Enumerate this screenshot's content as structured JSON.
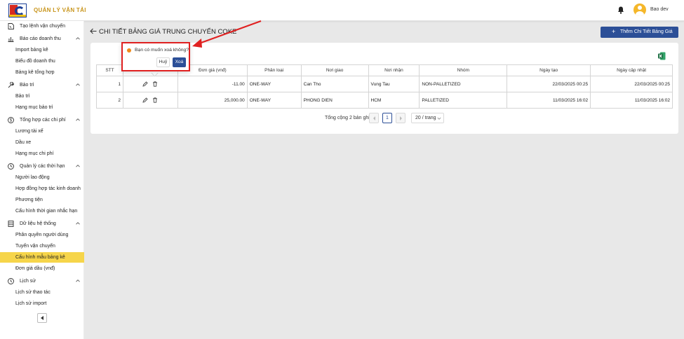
{
  "app": {
    "title": "QUẢN LÝ VẬN TẢI",
    "user": "Bao dev"
  },
  "sidebar": {
    "items": [
      {
        "type": "group",
        "icon": "file-icon",
        "label": "Tạo lệnh vận chuyển",
        "chevron": false
      },
      {
        "type": "group",
        "icon": "bar-chart-icon",
        "label": "Báo cáo doanh thu",
        "chevron": true
      },
      {
        "type": "sub",
        "label": "Import bảng kê"
      },
      {
        "type": "sub",
        "label": "Biểu đồ doanh thu"
      },
      {
        "type": "sub",
        "label": "Bảng kê tổng hợp"
      },
      {
        "type": "group",
        "icon": "wrench-icon",
        "label": "Bảo trì",
        "chevron": true
      },
      {
        "type": "sub",
        "label": "Bảo trì"
      },
      {
        "type": "sub",
        "label": "Hạng mục bảo trì"
      },
      {
        "type": "group",
        "icon": "dollar-icon",
        "label": "Tổng hợp các chi phí",
        "chevron": true
      },
      {
        "type": "sub",
        "label": "Lương tài xế"
      },
      {
        "type": "sub",
        "label": "Dầu xe"
      },
      {
        "type": "sub",
        "label": "Hạng mục chi phí"
      },
      {
        "type": "group",
        "icon": "clock-icon",
        "label": "Quản lý các thời hạn",
        "chevron": true
      },
      {
        "type": "sub",
        "label": "Người lao động"
      },
      {
        "type": "sub",
        "label": "Hợp đồng hợp tác kinh doanh"
      },
      {
        "type": "sub",
        "label": "Phương tiện"
      },
      {
        "type": "sub",
        "label": "Cấu hình thời gian nhắc hạn"
      },
      {
        "type": "group",
        "icon": "database-icon",
        "label": "Dữ liệu hệ thống",
        "chevron": true
      },
      {
        "type": "sub",
        "label": "Phân quyền người dùng"
      },
      {
        "type": "sub",
        "label": "Tuyến vận chuyển"
      },
      {
        "type": "sub",
        "label": "Cấu hình mẫu bảng kê",
        "active": true
      },
      {
        "type": "sub",
        "label": "Đơn giá dầu (vnđ)"
      },
      {
        "type": "group",
        "icon": "history-icon",
        "label": "Lịch sử",
        "chevron": true
      },
      {
        "type": "sub",
        "label": "Lịch sử thao tác"
      },
      {
        "type": "sub",
        "label": "Lịch sử import"
      }
    ]
  },
  "main": {
    "title": "CHI TIẾT BẢNG GIÁ TRUNG CHUYỂN COKE",
    "add_button": "Thêm Chi Tiết Bảng Giá",
    "table": {
      "headers": [
        "STT",
        "",
        "Đơn giá (vnđ)",
        "Phân loại",
        "Nơi giao",
        "Nơi nhận",
        "Nhóm",
        "Ngày tạo",
        "Ngày cập nhật"
      ],
      "rows": [
        {
          "stt": "1",
          "price": "-11.00",
          "type": "ONE-WAY",
          "from": "Can Tho",
          "to": "Vung Tau",
          "group": "NON-PALLETIZED",
          "created": "22/03/2025 00:25",
          "updated": "22/03/2025 00:25"
        },
        {
          "stt": "2",
          "price": "25,000.00",
          "type": "ONE-WAY",
          "from": "PHONG DIEN",
          "to": "HCM",
          "group": "PALLETIZED",
          "created": "11/03/2025 16:02",
          "updated": "11/03/2025 16:02"
        }
      ]
    },
    "pagination": {
      "total": "Tổng cộng 2 bản ghi",
      "current": "1",
      "page_size": "20 / trang"
    }
  },
  "popconfirm": {
    "message": "Bạn có muốn xoá không?",
    "cancel": "Huỷ",
    "ok": "Xoá"
  },
  "colors": {
    "primary": "#2c4f97",
    "active": "#f6d54a",
    "annotation": "#e02020",
    "brand_gold": "#c8941a"
  }
}
